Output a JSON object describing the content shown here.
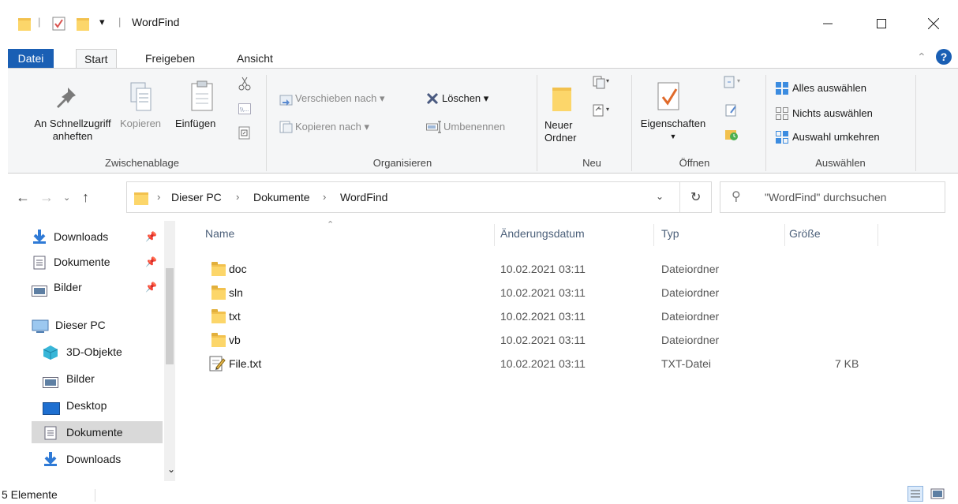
{
  "window": {
    "title": "WordFind",
    "qa_separator": "|",
    "qa_dropdown": "▾"
  },
  "ribbon_tabs": [
    "Datei",
    "Start",
    "Freigeben",
    "Ansicht"
  ],
  "ribbon": {
    "clipboard": {
      "pin_label_1": "An Schnellzugriff",
      "pin_label_2": "anheften",
      "copy": "Kopieren",
      "paste": "Einfügen",
      "group": "Zwischenablage"
    },
    "organize": {
      "move_to": "Verschieben nach",
      "copy_to": "Kopieren nach",
      "delete": "Löschen",
      "rename": "Umbenennen",
      "group": "Organisieren"
    },
    "new": {
      "new_folder_1": "Neuer",
      "new_folder_2": "Ordner",
      "group": "Neu"
    },
    "open": {
      "properties": "Eigenschaften",
      "group": "Öffnen"
    },
    "select": {
      "select_all": "Alles auswählen",
      "select_none": "Nichts auswählen",
      "invert": "Auswahl umkehren",
      "group": "Auswählen"
    }
  },
  "address": {
    "crumbs": [
      "Dieser PC",
      "Dokumente",
      "WordFind"
    ],
    "search_placeholder": "\"WordFind\" durchsuchen"
  },
  "nav": {
    "items": [
      {
        "label": "Downloads",
        "icon": "download-icon",
        "pinned": true
      },
      {
        "label": "Dokumente",
        "icon": "documents-icon",
        "pinned": true
      },
      {
        "label": "Bilder",
        "icon": "pictures-icon",
        "pinned": true
      },
      {
        "label": "Dieser PC",
        "icon": "computer-icon",
        "pinned": false
      },
      {
        "label": "3D-Objekte",
        "icon": "3d-objects-icon",
        "pinned": false
      },
      {
        "label": "Bilder",
        "icon": "pictures-icon",
        "pinned": false
      },
      {
        "label": "Desktop",
        "icon": "desktop-icon",
        "pinned": false
      },
      {
        "label": "Dokumente",
        "icon": "documents-icon",
        "pinned": false,
        "selected": true
      },
      {
        "label": "Downloads",
        "icon": "download-icon",
        "pinned": false
      }
    ]
  },
  "columns": {
    "name": "Name",
    "date": "Änderungsdatum",
    "type": "Typ",
    "size": "Größe"
  },
  "files": [
    {
      "name": "doc",
      "date": "10.02.2021 03:11",
      "type": "Dateiordner",
      "size": "",
      "icon": "folder-icon"
    },
    {
      "name": "sln",
      "date": "10.02.2021 03:11",
      "type": "Dateiordner",
      "size": "",
      "icon": "folder-icon"
    },
    {
      "name": "txt",
      "date": "10.02.2021 03:11",
      "type": "Dateiordner",
      "size": "",
      "icon": "folder-icon"
    },
    {
      "name": "vb",
      "date": "10.02.2021 03:11",
      "type": "Dateiordner",
      "size": "",
      "icon": "folder-icon"
    },
    {
      "name": "File.txt",
      "date": "10.02.2021 03:11",
      "type": "TXT-Datei",
      "size": "7 KB",
      "icon": "text-file-icon"
    }
  ],
  "status": {
    "count": "5 Elemente"
  },
  "colors": {
    "accent": "#1a5fb4",
    "folder": "#f2c14e",
    "header_text": "#4c607a"
  }
}
